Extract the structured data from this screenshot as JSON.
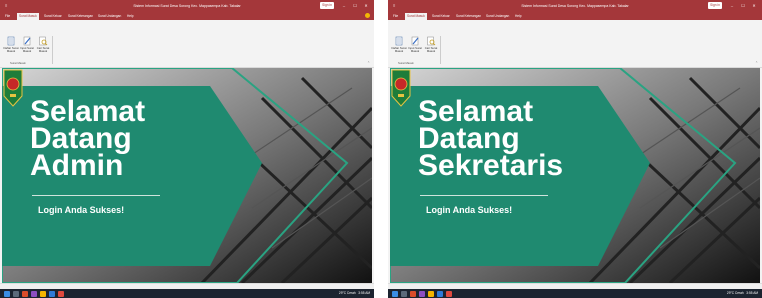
{
  "screens": [
    {
      "app_title_short": "Access",
      "window_title": "Sistem Informasi Surat Desa Sorong Kec. Mappasempa Kab. Takalar",
      "sign_in": "Sign in",
      "tabs": [
        "File",
        "Surat Masuk",
        "Surat Keluar",
        "Surat Keterangan",
        "Surat Undangan",
        "Help"
      ],
      "active_tab": 1,
      "ribbon_buttons": [
        "Daftar Surat Masuk",
        "Input Surat Masuk",
        "Cari Surat Masuk"
      ],
      "group_label": "Surat Masuk",
      "welcome_lines": [
        "Selamat",
        "Datang",
        "Admin"
      ],
      "success_text": "Login Anda Sukses!",
      "tray_text": "29°C Cerah",
      "time": "3:55 AM"
    },
    {
      "app_title_short": "Access",
      "window_title": "Sistem Informasi Surat Desa Sorong Kec. Mappasempa Kab. Takalar",
      "sign_in": "Sign in",
      "tabs": [
        "File",
        "Surat Masuk",
        "Surat Keluar",
        "Surat Keterangan",
        "Surat Undangan",
        "Help"
      ],
      "active_tab": 1,
      "ribbon_buttons": [
        "Daftar Surat Masuk",
        "Input Surat Masuk",
        "Cari Surat Masuk"
      ],
      "group_label": "Surat Masuk",
      "welcome_lines": [
        "Selamat",
        "Datang",
        "Sekretaris"
      ],
      "success_text": "Login Anda Sukses!",
      "tray_text": "29°C Cerah",
      "time": "3:55 AM"
    }
  ],
  "colors": {
    "title_bar": "#a4373a",
    "teal_panel": "#1f8a70",
    "teal_outline": "#2aa382",
    "taskbar": "#1c2430"
  },
  "icons": [
    "document-list-icon",
    "pencil-edit-icon",
    "search-document-icon",
    "regency-emblem-logo"
  ]
}
